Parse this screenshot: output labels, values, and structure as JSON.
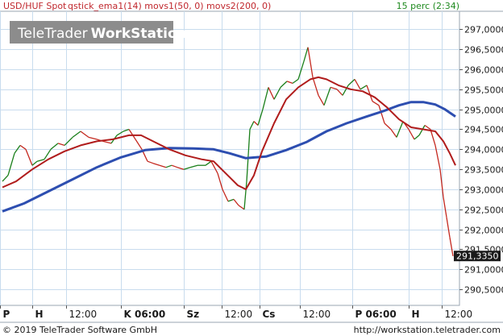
{
  "header": {
    "instrument": "USD/HUF Spot",
    "indicators": "qstick_ema1(14) movs1(50, 0) movs2(200, 0)",
    "interval": "15 perc (2:34)"
  },
  "watermark": {
    "part1": "TeleTrader",
    "part2": "WorkStation"
  },
  "footer": {
    "copyright": "© 2019 TeleTrader Software GmbH",
    "url": "http://workstation.teletrader.com"
  },
  "colors": {
    "background": "#ffffff",
    "grid": "#c8dcee",
    "price": "#1a7f1a",
    "price_down": "#c4281f",
    "ma50": "#b01c1c",
    "ma200": "#2d4eb0",
    "last_price_tag": "#1a1a1a"
  },
  "chart_data": {
    "type": "line",
    "title": "USD/HUF Spot",
    "y_ticks": [
      290.5,
      291.0,
      291.5,
      292.0,
      292.5,
      293.0,
      293.5,
      294.0,
      294.5,
      295.0,
      295.5,
      296.0,
      296.5,
      297.0
    ],
    "y_tick_labels": [
      "290,5000",
      "291,0000",
      "291,5000",
      "292,0000",
      "292,5000",
      "293,0000",
      "293,5000",
      "294,0000",
      "294,5000",
      "295,0000",
      "295,5000",
      "296,0000",
      "296,5000",
      "297,0000"
    ],
    "ylim": [
      290.1,
      297.45
    ],
    "x_tick_labels": [
      "P",
      "H",
      "12:00",
      "K 06:00",
      "Sz",
      "12:00",
      "Cs",
      "12:00",
      "P 06:00",
      "H",
      "12:00"
    ],
    "x_tick_positions": [
      0,
      40,
      82,
      150,
      228,
      275,
      322,
      372,
      437,
      507,
      548
    ],
    "x_range": [
      0,
      570
    ],
    "last_price": 291.335,
    "last_price_label": "291,3350",
    "series": [
      {
        "key": "price",
        "x": [
          3,
          10,
          18,
          25,
          32,
          40,
          46,
          55,
          63,
          72,
          80,
          90,
          100,
          110,
          120,
          128,
          138,
          145,
          153,
          160,
          168,
          176,
          183,
          190,
          198,
          206,
          213,
          220,
          228,
          236,
          245,
          255,
          262,
          270,
          276,
          283,
          290,
          296,
          303,
          306,
          310,
          315,
          320,
          326,
          333,
          340,
          348,
          356,
          363,
          370,
          377,
          382,
          388,
          395,
          402,
          410,
          418,
          425,
          432,
          440,
          447,
          455,
          462,
          470,
          477,
          485,
          492,
          500,
          507,
          514,
          520,
          527,
          534,
          540,
          546,
          550,
          554,
          558,
          562
        ],
        "values": [
          293.2,
          293.35,
          293.9,
          294.1,
          294.0,
          293.6,
          293.7,
          293.75,
          294.0,
          294.15,
          294.1,
          294.3,
          294.45,
          294.3,
          294.25,
          294.2,
          294.15,
          294.35,
          294.45,
          294.5,
          294.25,
          294.0,
          293.7,
          293.65,
          293.6,
          293.55,
          293.6,
          293.55,
          293.5,
          293.55,
          293.6,
          293.6,
          293.7,
          293.4,
          293.0,
          292.7,
          292.75,
          292.6,
          292.5,
          293.2,
          294.5,
          294.7,
          294.6,
          295.0,
          295.55,
          295.25,
          295.55,
          295.7,
          295.65,
          295.75,
          296.2,
          296.55,
          295.8,
          295.35,
          295.1,
          295.55,
          295.5,
          295.35,
          295.6,
          295.75,
          295.5,
          295.6,
          295.2,
          295.1,
          294.65,
          294.5,
          294.3,
          294.7,
          294.5,
          294.25,
          294.35,
          294.6,
          294.5,
          294.1,
          293.5,
          292.8,
          292.3,
          291.8,
          291.33
        ]
      },
      {
        "key": "ma50",
        "x": [
          3,
          20,
          40,
          60,
          80,
          100,
          120,
          140,
          160,
          175,
          190,
          210,
          230,
          250,
          265,
          275,
          285,
          295,
          305,
          315,
          325,
          340,
          355,
          370,
          385,
          395,
          405,
          420,
          435,
          450,
          465,
          480,
          495,
          510,
          525,
          540,
          550,
          558,
          565
        ],
        "values": [
          293.05,
          293.2,
          293.5,
          293.75,
          293.95,
          294.1,
          294.2,
          294.25,
          294.35,
          294.35,
          294.2,
          294.0,
          293.85,
          293.75,
          293.7,
          293.5,
          293.3,
          293.1,
          293.0,
          293.35,
          293.95,
          294.65,
          295.25,
          295.55,
          295.75,
          295.8,
          295.75,
          295.6,
          295.5,
          295.45,
          295.3,
          295.05,
          294.75,
          294.55,
          294.5,
          294.45,
          294.2,
          293.9,
          293.6
        ]
      },
      {
        "key": "ma200",
        "x": [
          3,
          30,
          60,
          90,
          120,
          150,
          180,
          210,
          240,
          265,
          285,
          305,
          330,
          355,
          380,
          405,
          430,
          455,
          475,
          495,
          510,
          525,
          540,
          552,
          565
        ],
        "values": [
          292.45,
          292.65,
          292.95,
          293.25,
          293.55,
          293.8,
          293.98,
          294.03,
          294.02,
          294.0,
          293.9,
          293.78,
          293.82,
          293.98,
          294.18,
          294.45,
          294.65,
          294.82,
          294.95,
          295.1,
          295.18,
          295.18,
          295.12,
          295.0,
          294.82
        ]
      }
    ]
  }
}
